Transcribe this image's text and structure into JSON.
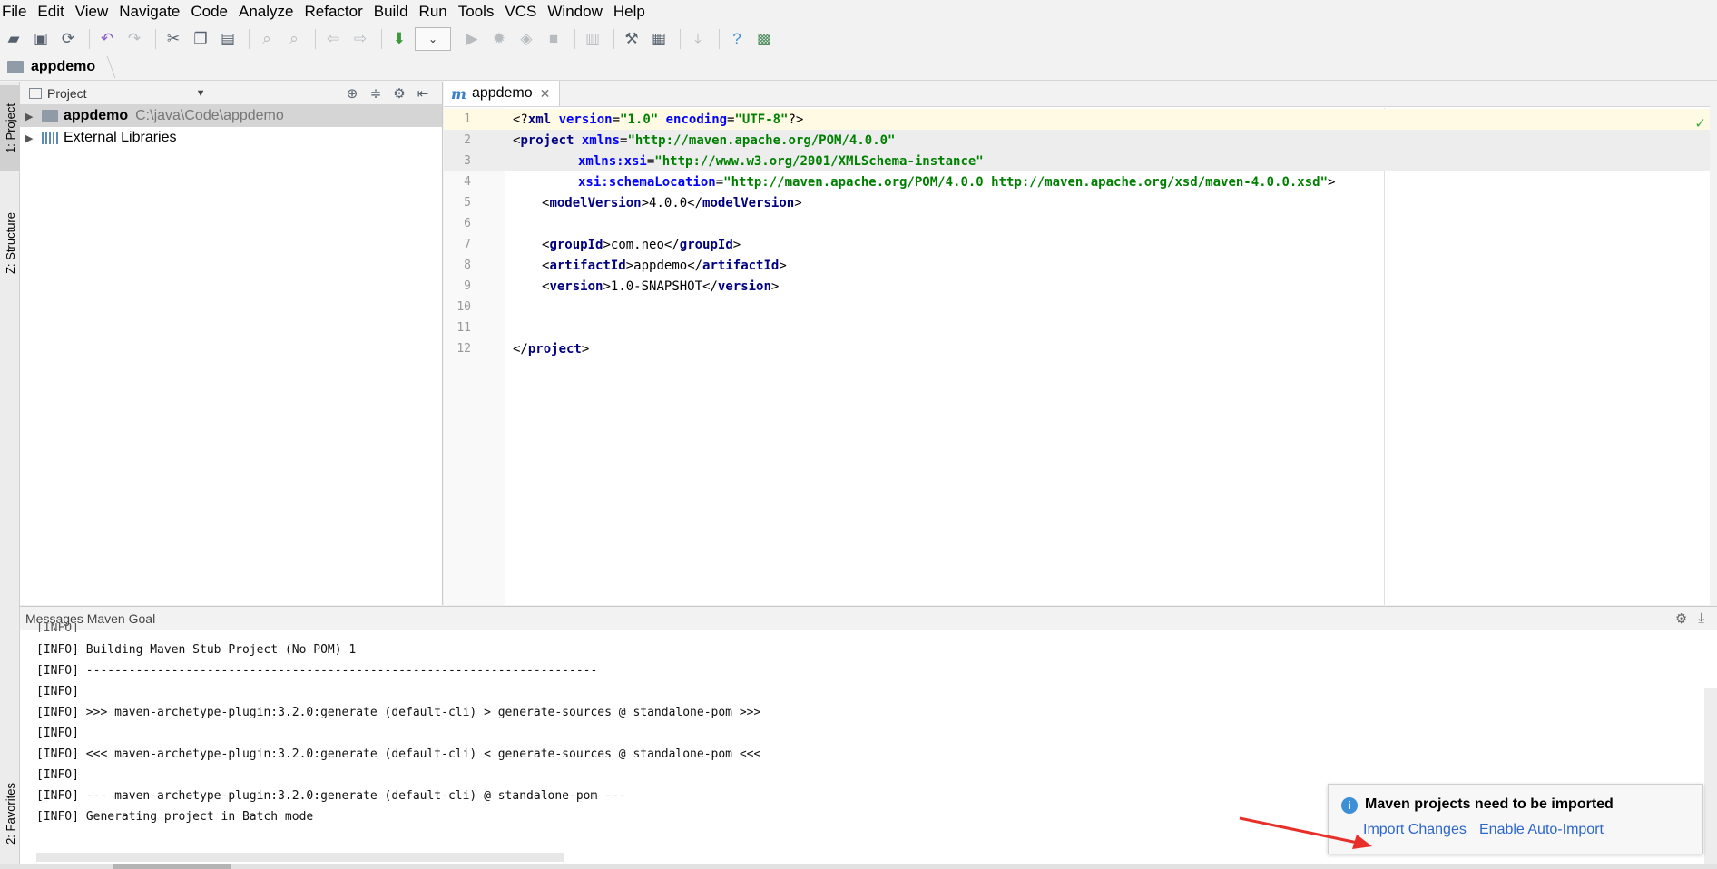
{
  "menu": [
    "File",
    "Edit",
    "View",
    "Navigate",
    "Code",
    "Analyze",
    "Refactor",
    "Build",
    "Run",
    "Tools",
    "VCS",
    "Window",
    "Help"
  ],
  "navbar": {
    "breadcrumb": "appdemo"
  },
  "left_strip": {
    "project_tab": "1: Project",
    "structure_tab": "Z: Structure",
    "favorites_tab": "2: Favorites"
  },
  "project_panel": {
    "title": "Project",
    "tree": [
      {
        "name": "appdemo",
        "path": "C:\\java\\Code\\appdemo"
      },
      {
        "name": "External Libraries"
      }
    ]
  },
  "editor": {
    "tab_label": "appdemo",
    "tab_icon": "maven-icon",
    "lines": [
      {
        "n": "1"
      },
      {
        "n": "2"
      },
      {
        "n": "3"
      },
      {
        "n": "4"
      },
      {
        "n": "5"
      },
      {
        "n": "6"
      },
      {
        "n": "7"
      },
      {
        "n": "8"
      },
      {
        "n": "9"
      },
      {
        "n": "10"
      },
      {
        "n": "11"
      },
      {
        "n": "12"
      }
    ],
    "code": {
      "l1": {
        "a": "<?",
        "b": "xml ",
        "c": "version",
        "d": "=",
        "e": "\"1.0\"",
        "f": " encoding",
        "g": "=",
        "h": "\"UTF-8\"",
        "i": "?>"
      },
      "l2": {
        "a": "<",
        "b": "project ",
        "c": "xmlns",
        "d": "=",
        "e": "\"http://maven.apache.org/POM/4.0.0\""
      },
      "l3": {
        "c": "xmlns:xsi",
        "d": "=",
        "e": "\"http://www.w3.org/2001/XMLSchema-instance\""
      },
      "l4": {
        "c": "xsi:schemaLocation",
        "d": "=",
        "e": "\"http://maven.apache.org/POM/4.0.0 http://maven.apache.org/xsd/maven-4.0.0.xsd\"",
        "f": ">"
      },
      "l5": {
        "a": "<",
        "b": "modelVersion",
        "c": ">",
        "d": "4.0.0",
        "e": "</",
        "f": "modelVersion",
        "g": ">"
      },
      "l7": {
        "a": "<",
        "b": "groupId",
        "c": ">",
        "d": "com.neo",
        "e": "</",
        "f": "groupId",
        "g": ">"
      },
      "l8": {
        "a": "<",
        "b": "artifactId",
        "c": ">",
        "d": "appdemo",
        "e": "</",
        "f": "artifactId",
        "g": ">"
      },
      "l9": {
        "a": "<",
        "b": "version",
        "c": ">",
        "d": "1.0-SNAPSHOT",
        "e": "</",
        "f": "version",
        "g": ">"
      },
      "l12": {
        "a": "</",
        "b": "project",
        "c": ">"
      }
    }
  },
  "messages": {
    "title": "Messages Maven Goal",
    "log": [
      "[INFO] Building Maven Stub Project (No POM) 1",
      "[INFO] ------------------------------------------------------------------------",
      "[INFO]",
      "[INFO] >>> maven-archetype-plugin:3.2.0:generate (default-cli) > generate-sources @ standalone-pom >>>",
      "[INFO]",
      "[INFO] <<< maven-archetype-plugin:3.2.0:generate (default-cli) < generate-sources @ standalone-pom <<<",
      "[INFO]",
      "[INFO] --- maven-archetype-plugin:3.2.0:generate (default-cli) @ standalone-pom ---",
      "[INFO] Generating project in Batch mode"
    ],
    "partial_top_line": "[INFO]"
  },
  "notification": {
    "title": "Maven projects need to be imported",
    "import_changes": "Import Changes",
    "enable_auto_import": "Enable Auto-Import"
  },
  "colors": {
    "accent": "#2d67cc",
    "annotation_arrow": "#e8302a"
  }
}
